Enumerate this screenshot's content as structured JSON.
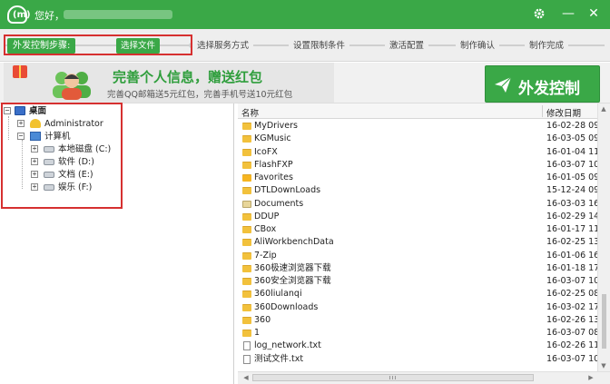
{
  "titlebar": {
    "greeting": "您好，",
    "logo_text": "(m)",
    "settings_icon": "gear-icon",
    "minimize_glyph": "—",
    "close_glyph": "✕"
  },
  "steps": {
    "label": "外发控制步骤:",
    "items": [
      "选择文件",
      "选择服务方式",
      "设置限制条件",
      "激活配置",
      "制作确认",
      "制作完成"
    ],
    "active_index": 0
  },
  "banner": {
    "title": "完善个人信息，赠送红包",
    "subtitle": "完善QQ邮箱送5元红包，完善手机号送10元红包",
    "button_label": "外发控制",
    "button_icon": "paper-plane-icon"
  },
  "tree": {
    "root": "桌面",
    "user": "Administrator",
    "computer": "计算机",
    "drives": [
      "本地磁盘 (C:)",
      "软件 (D:)",
      "文档 (E:)",
      "娱乐 (F:)"
    ]
  },
  "files": {
    "col_name": "名称",
    "col_date": "修改日期",
    "rows": [
      {
        "name": "MyDrivers",
        "date": "16-02-28 09:",
        "type": "folder"
      },
      {
        "name": "KGMusic",
        "date": "16-03-05 09:",
        "type": "folder"
      },
      {
        "name": "IcoFX",
        "date": "16-01-04 11:",
        "type": "folder"
      },
      {
        "name": "FlashFXP",
        "date": "16-03-07 10:",
        "type": "folder"
      },
      {
        "name": "Favorites",
        "date": "16-01-05 09:",
        "type": "favorites"
      },
      {
        "name": "DTLDownLoads",
        "date": "15-12-24 09:",
        "type": "folder"
      },
      {
        "name": "Documents",
        "date": "16-03-03 16:",
        "type": "documents"
      },
      {
        "name": "DDUP",
        "date": "16-02-29 14:",
        "type": "folder"
      },
      {
        "name": "CBox",
        "date": "16-01-17 11:",
        "type": "folder"
      },
      {
        "name": "AliWorkbenchData",
        "date": "16-02-25 13:",
        "type": "folder"
      },
      {
        "name": "7-Zip",
        "date": "16-01-06 16:",
        "type": "folder"
      },
      {
        "name": "360极速浏览器下载",
        "date": "16-01-18 17:",
        "type": "folder"
      },
      {
        "name": "360安全浏览器下载",
        "date": "16-03-07 10:",
        "type": "folder"
      },
      {
        "name": "360liulanqi",
        "date": "16-02-25 08:",
        "type": "folder"
      },
      {
        "name": "360Downloads",
        "date": "16-03-02 17:",
        "type": "folder"
      },
      {
        "name": "360",
        "date": "16-02-26 13:",
        "type": "folder"
      },
      {
        "name": "1",
        "date": "16-03-07 08:",
        "type": "folder"
      },
      {
        "name": "log_network.txt",
        "date": "16-02-26 11:",
        "type": "file"
      },
      {
        "name": "测试文件.txt",
        "date": "16-03-07 10:",
        "type": "file"
      }
    ]
  },
  "colors": {
    "accent": "#3aa847",
    "highlight_box": "#d63030"
  }
}
